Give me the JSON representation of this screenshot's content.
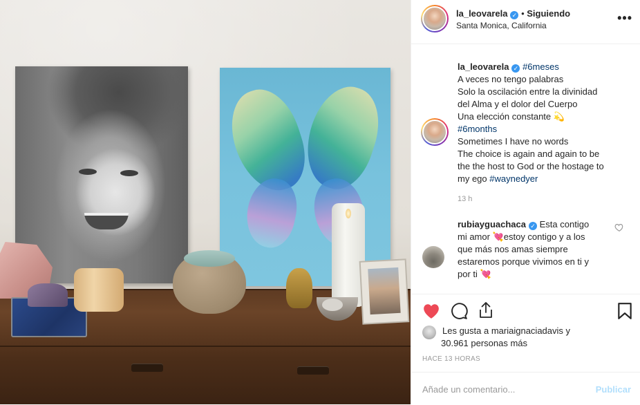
{
  "post": {
    "author": "la_leovarela",
    "follow_separator": "•",
    "follow_status": "Siguiendo",
    "location": "Santa Monica, California",
    "more_icon": "more-dots-icon",
    "verified_icon": "verified-badge-icon"
  },
  "caption": {
    "author": "la_leovarela",
    "hashtag1": "#6meses",
    "line1": "A veces no tengo palabras",
    "line2": "Solo la oscilación entre la divinidad",
    "line3": "del Alma y el dolor del Cuerpo",
    "line4": "Una elección constante 💫",
    "hashtag2": "#6months",
    "line5": "Sometimes I have no words",
    "line6": "The choice is again and again to be",
    "line7": "the the host to God or the hostage to",
    "line8_prefix": "my ego",
    "hashtag3": "#waynedyer",
    "time": "13 h"
  },
  "comment": {
    "author": "rubiayguachaca",
    "line1": "Esta contigo",
    "line2": "mi amor 💘estoy contigo y a los",
    "line3": "que más nos amas siempre",
    "line4": "estaremos porque vivimos en ti y",
    "line5": "por ti 💘"
  },
  "likes": {
    "line1_prefix": "Les gusta a",
    "liker": "mariaignaciadavis",
    "line1_suffix": "y",
    "count": "30.961",
    "line2_suffix": "personas más"
  },
  "posted_time": "HACE 13 HORAS",
  "add_comment": {
    "placeholder": "Añade un comentario...",
    "publish_label": "Publicar"
  },
  "colors": {
    "like_red": "#ed4956",
    "link_blue": "#003569",
    "verified_blue": "#3897f0",
    "publish_disabled": "#b2dffc"
  }
}
